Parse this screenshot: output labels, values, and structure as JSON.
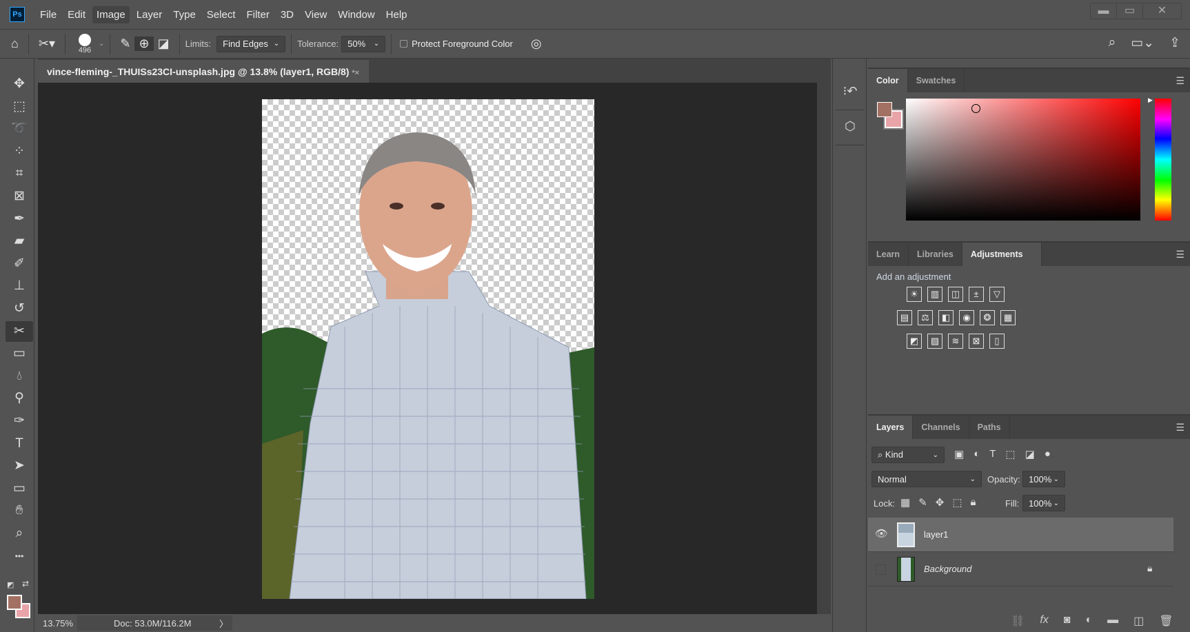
{
  "app": {
    "logo": "Ps",
    "menu": [
      "File",
      "Edit",
      "Image",
      "Layer",
      "Type",
      "Select",
      "Filter",
      "3D",
      "View",
      "Window",
      "Help"
    ],
    "active_menu": "Image",
    "window_controls": [
      "minimize-icon",
      "maximize-icon",
      "close-icon"
    ]
  },
  "options": {
    "brush_size": "496",
    "limits_label": "Limits:",
    "limits_value": "Find Edges",
    "tolerance_label": "Tolerance:",
    "tolerance_value": "50%",
    "protect_label": "Protect Foreground Color",
    "protect_checked": false
  },
  "document": {
    "tab_title": "vince-fleming-_THUISs23CI-unsplash.jpg @ 13.8% (layer1, RGB/8)",
    "tab_close": "*×"
  },
  "status": {
    "zoom": "13.75%",
    "doc": "Doc: 53.0M/116.2M",
    "arrow": "〉"
  },
  "colors": {
    "foreground": "#a37163",
    "background": "#e8a4a8",
    "hue": "#ff0000"
  },
  "color_panel": {
    "tabs": [
      "Color",
      "Swatches"
    ],
    "active": "Color"
  },
  "adjust_panel": {
    "tabs": [
      "Learn",
      "Libraries",
      "Adjustments"
    ],
    "active": "Adjustments",
    "heading": "Add an adjustment",
    "rows": [
      [
        "☀",
        "▥",
        "◫",
        "±",
        "▽"
      ],
      [
        "▤",
        "⚖",
        "◧",
        "◉",
        "❂",
        "▦"
      ],
      [
        "◩",
        "▨",
        "≋",
        "⊠",
        "▯"
      ]
    ]
  },
  "layers_panel": {
    "tabs": [
      "Layers",
      "Channels",
      "Paths"
    ],
    "active": "Layers",
    "filter": "Kind",
    "blend_mode": "Normal",
    "opacity_label": "Opacity:",
    "opacity": "100%",
    "lock_label": "Lock:",
    "fill_label": "Fill:",
    "fill": "100%",
    "layers": [
      {
        "name": "layer1",
        "visible": true,
        "selected": true
      },
      {
        "name": "Background",
        "visible": false,
        "locked": true
      }
    ]
  }
}
